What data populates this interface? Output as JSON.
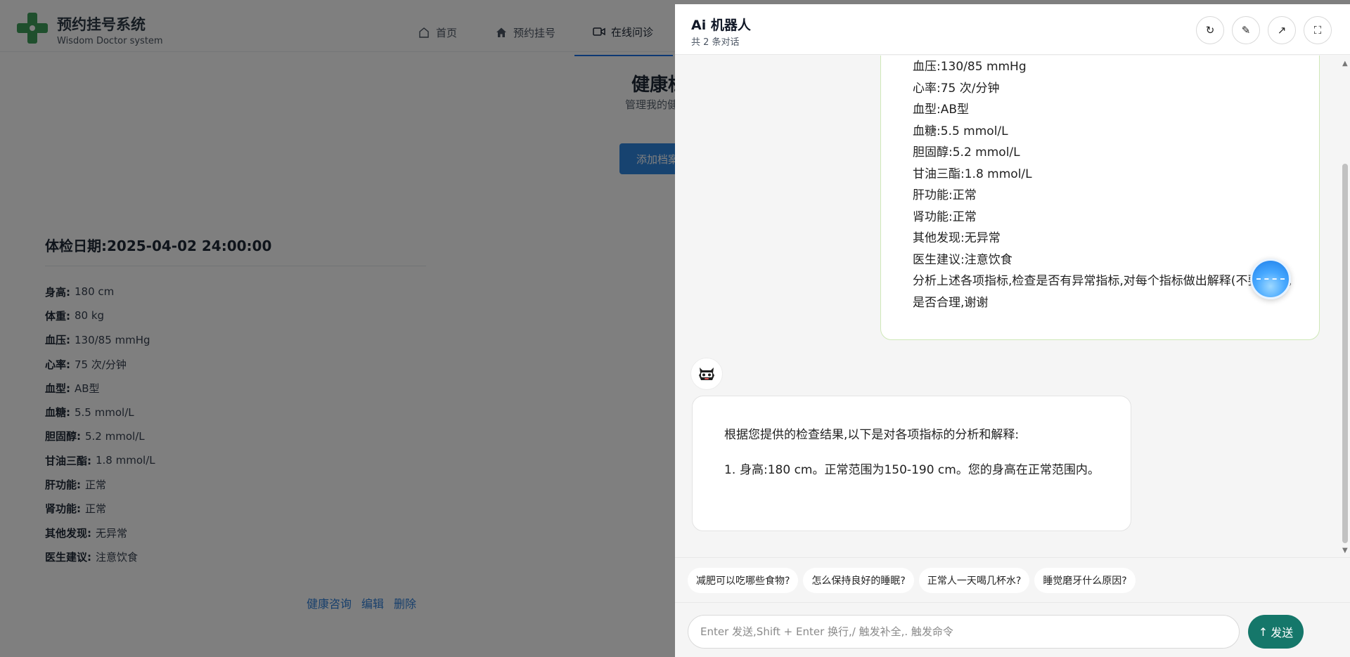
{
  "app": {
    "title": "预约挂号系统",
    "subtitle": "Wisdom Doctor system",
    "nav": [
      {
        "label": "首页",
        "icon": "home-outline-icon"
      },
      {
        "label": "预约挂号",
        "icon": "home-filled-icon"
      },
      {
        "label": "在线问诊",
        "icon": "video-icon",
        "active": true
      }
    ],
    "page_heading": "健康档案",
    "page_desc": "管理我的健康档案",
    "add_button": "添加档案"
  },
  "record": {
    "title_label": "体检日期:",
    "title_value": "2025-04-02 24:00:00",
    "fields": [
      {
        "label": "身高:",
        "value": "180 cm"
      },
      {
        "label": "体重:",
        "value": "80 kg"
      },
      {
        "label": "血压:",
        "value": "130/85 mmHg"
      },
      {
        "label": "心率:",
        "value": "75 次/分钟"
      },
      {
        "label": "血型:",
        "value": "AB型"
      },
      {
        "label": "血糖:",
        "value": "5.5 mmol/L"
      },
      {
        "label": "胆固醇:",
        "value": "5.2 mmol/L"
      },
      {
        "label": "甘油三酯:",
        "value": "1.8 mmol/L"
      },
      {
        "label": "肝功能:",
        "value": "正常"
      },
      {
        "label": "肾功能:",
        "value": "正常"
      },
      {
        "label": "其他发现:",
        "value": "无异常"
      },
      {
        "label": "医生建议:",
        "value": "注意饮食"
      }
    ],
    "actions": {
      "consult": "健康咨询",
      "edit": "编辑",
      "delete": "删除"
    }
  },
  "chat": {
    "title": "Ai 机器人",
    "subtitle": "共 2 条对话",
    "header_buttons": [
      {
        "name": "refresh-button",
        "icon": "refresh-icon",
        "glyph": "↻"
      },
      {
        "name": "clear-button",
        "icon": "brush-icon",
        "glyph": "✎"
      },
      {
        "name": "open-external-button",
        "icon": "arrow-up-right-icon",
        "glyph": "↗"
      },
      {
        "name": "fullscreen-button",
        "icon": "fullscreen-icon",
        "glyph": "⛶"
      }
    ],
    "user_message": {
      "lines": [
        "血压:130/85 mmHg",
        "心率:75 次/分钟",
        "血型:AB型",
        "血糖:5.5 mmol/L",
        "胆固醇:5.2 mmol/L",
        "甘油三酯:1.8 mmol/L",
        "肝功能:正常",
        "肾功能:正常",
        "其他发现:无异常",
        "医生建议:注意饮食"
      ],
      "closing": "分析上述各项指标,检查是否有异常指标,对每个指标做出解释(不要省略),是否合理,谢谢"
    },
    "bot_message": {
      "intro": "根据您提供的检查结果,以下是对各项指标的分析和解释:",
      "items": [
        {
          "num": "1.",
          "text": "身高:180 cm。正常范围为150-190 cm。您的身高在正常范围内。"
        }
      ]
    },
    "suggestions": [
      "减肥可以吃哪些食物?",
      "怎么保持良好的睡眠?",
      "正常人一天喝几杯水?",
      "睡觉磨牙什么原因?"
    ],
    "input_placeholder": "Enter 发送,Shift + Enter 换行,/ 触发补全,. 触发命令",
    "send_label": "发送",
    "send_glyph": "↑"
  }
}
